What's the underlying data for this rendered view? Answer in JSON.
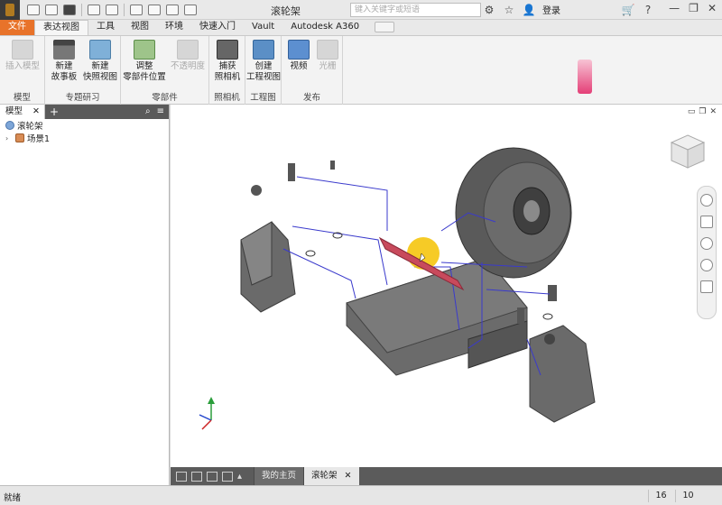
{
  "title_bar": {
    "document_title": "滚轮架",
    "search_placeholder": "键入关键字或短语",
    "login_label": "登录",
    "help_label": "?"
  },
  "tabs": [
    {
      "label": "文件"
    },
    {
      "label": "表达视图"
    },
    {
      "label": "工具"
    },
    {
      "label": "视图"
    },
    {
      "label": "环境"
    },
    {
      "label": "快速入门"
    },
    {
      "label": "Vault"
    },
    {
      "label": "Autodesk A360"
    }
  ],
  "ribbon": {
    "panels": [
      {
        "title": "模型",
        "buttons": [
          {
            "label": "插入模型",
            "enabled": false
          }
        ]
      },
      {
        "title": "专题研习",
        "buttons": [
          {
            "label": "新建\n故事板"
          },
          {
            "label": "新建\n快照视图"
          }
        ]
      },
      {
        "title": "零部件",
        "buttons": [
          {
            "label": "调整\n零部件位置"
          },
          {
            "label": "不透明度",
            "enabled": false
          }
        ]
      },
      {
        "title": "照相机",
        "buttons": [
          {
            "label": "捕获\n照相机"
          }
        ]
      },
      {
        "title": "工程图",
        "buttons": [
          {
            "label": "创建\n工程视图"
          }
        ]
      },
      {
        "title": "发布",
        "buttons": [
          {
            "label": "视频"
          },
          {
            "label": "光栅",
            "enabled": false
          }
        ]
      }
    ]
  },
  "browser": {
    "tab_label": "模型",
    "tree": [
      {
        "label": "滚轮架",
        "icon": "assembly-icon"
      },
      {
        "label": "场景1",
        "icon": "scene-icon"
      }
    ]
  },
  "document_tabs": [
    {
      "label": "我的主页"
    },
    {
      "label": "滚轮架",
      "active": true
    }
  ],
  "status_bar": {
    "text": "就绪",
    "count_a": "16",
    "count_b": "10"
  },
  "colors": {
    "file_tab": "#e8732a",
    "model_gray": "#5a5a5a",
    "shaft_red": "#c84a5c",
    "trail_blue": "#3a3acc",
    "cursor_highlight": "#f5c200"
  }
}
